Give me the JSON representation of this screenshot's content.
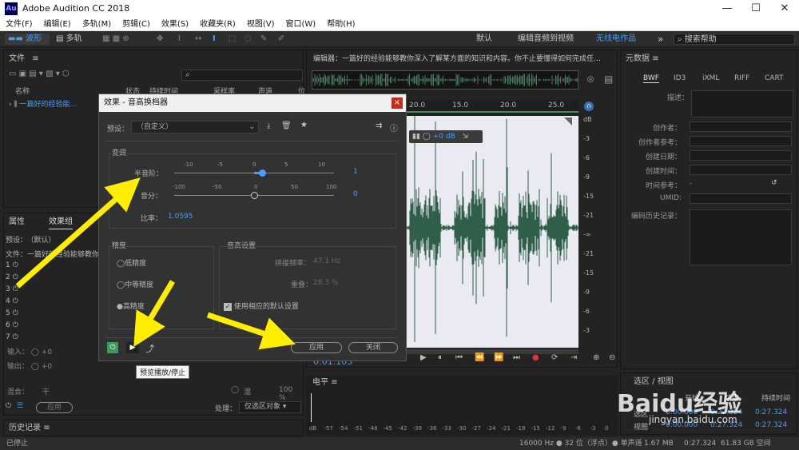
{
  "window": {
    "title": "Adobe Audition CC 2018",
    "logo": "Au",
    "controls": [
      "—",
      "☐",
      "✕"
    ]
  },
  "menu": [
    "文件(F)",
    "编辑(E)",
    "多轨(M)",
    "剪辑(C)",
    "效果(S)",
    "收藏夹(R)",
    "视图(V)",
    "窗口(W)",
    "帮助(H)"
  ],
  "toolbar": {
    "waveform": "波形",
    "multitrack": "多轨",
    "workspaces": [
      "默认",
      "编辑音频到视频",
      "无线电作品"
    ],
    "more": "»",
    "search_placeholder": "搜索帮助"
  },
  "files_panel": {
    "title": "文件",
    "columns": [
      "名称",
      "状态",
      "持续时间",
      "采样率",
      "声道",
      "位"
    ],
    "item": "一篇好的经验能…"
  },
  "editor": {
    "title": "编辑器：一篇好的经验能够教你深入了解某方面的知识和内容。你不止要懂得如何完成任…",
    "ruler": [
      "20.0",
      "15.0",
      "20.0",
      "25.0"
    ],
    "hud": "+0 dB",
    "db_labels": [
      "dB",
      "-3",
      "-6",
      "-9",
      "-15",
      "-21",
      "-∞",
      "-21",
      "-15",
      "-9",
      "-6",
      "-3"
    ],
    "time": "0:01.103"
  },
  "metadata_panel": {
    "title": "元数据",
    "tabs": [
      "BWF",
      "ID3",
      "iXML",
      "RIFF",
      "CART"
    ],
    "desc_label": "描述：",
    "fields": [
      "创作者：",
      "创作者参考：",
      "创建日期：",
      "创建时间：",
      "时间参考：",
      "UMID:",
      "编码历史记录："
    ],
    "time_ref_value": "-"
  },
  "effects_panel": {
    "tabs": [
      "属性",
      "效果组"
    ],
    "preset_label": "预设：",
    "preset_value": "（默认）",
    "file_label": "文件：一篇好的经验能够教你",
    "rack_numbers": [
      "1",
      "2",
      "3",
      "4",
      "5",
      "6",
      "7"
    ],
    "input_label": "输入：",
    "output_label": "输出：",
    "input_value": "+0",
    "output_value": "+0",
    "mix_label": "混合：",
    "mix_dry": "干",
    "mix_wet": "湿",
    "mix_percent": "100 %",
    "apply": "应用",
    "process_label": "处理：",
    "process_value": "仅选区对象"
  },
  "history_panel": {
    "title": "历史记录"
  },
  "level_panel": {
    "title": "电平",
    "scale": [
      "dB",
      "-57",
      "-54",
      "-51",
      "-48",
      "-45",
      "-42",
      "-39",
      "-36",
      "-33",
      "-30",
      "-27",
      "-24",
      "-21",
      "-18",
      "-15",
      "-12",
      "-9",
      "-6",
      "-3",
      "0"
    ]
  },
  "selection_panel": {
    "title": "选区 / 视图",
    "cols": [
      "开始",
      "结束",
      "持续时间"
    ],
    "row_selection": [
      "选区",
      "0:00.000",
      "0:27.324",
      "0:27.324"
    ],
    "row_view": [
      "视图",
      "0:00.000",
      "0:27.324",
      "0:27.324"
    ]
  },
  "transport_buttons": [
    "stop",
    "play",
    "pause",
    "to-start",
    "rewind",
    "forward",
    "to-end",
    "record",
    "loop",
    "skip"
  ],
  "status": {
    "left": "已停止",
    "right": [
      "16000 Hz ● 32 位（浮点）● 单声道",
      "1.67 MB",
      "0:27.324",
      "61.83 GB 空间"
    ]
  },
  "dialog": {
    "title": "效果 - 音高换档器",
    "preset_label": "预设：",
    "preset_value": "（自定义）",
    "section_shift": "变调",
    "semitone_label": "半音阶：",
    "semitone_scale": [
      "-10",
      "-5",
      "0",
      "5",
      "10"
    ],
    "semitone_value": "1",
    "semitone_level": 0.55,
    "cents_label": "音分：",
    "cents_scale": [
      "-100",
      "-50",
      "0",
      "50",
      "100"
    ],
    "cents_value": "0",
    "cents_level": 0.5,
    "ratio_label": "比率：",
    "ratio_value": "1.0595",
    "precision_title": "精度",
    "precision_options": [
      "低精度",
      "中等精度",
      "高精度"
    ],
    "pitch_title": "音高设置",
    "splice_label": "拼接频率：",
    "splice_value": "47.1 Hz",
    "overlap_label": "重叠：",
    "overlap_value": "28.3 %",
    "default_checkbox": "使用相应的默认设置",
    "apply": "应用",
    "close": "关闭",
    "tooltip": "预览播放/停止"
  },
  "watermark": {
    "brand": "Baidu经验",
    "url": "jingyan.baidu.com"
  },
  "colors": {
    "accent": "#4b9cf5",
    "waveform": "#2f5f48",
    "arrow": "#ffee00",
    "record": "#e03333",
    "power": "#3c9a5b"
  }
}
